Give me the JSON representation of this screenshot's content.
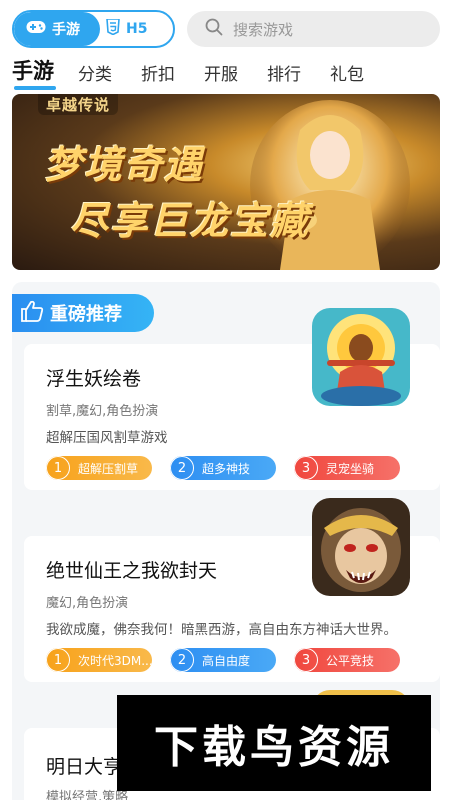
{
  "header": {
    "tabs": [
      {
        "label": "手游",
        "icon": "gamepad-icon",
        "active": true
      },
      {
        "label": "H5",
        "icon": "html5-icon",
        "active": false
      }
    ],
    "search": {
      "placeholder": "搜索游戏",
      "icon": "search-icon"
    }
  },
  "nav": {
    "items": [
      "手游",
      "分类",
      "折扣",
      "开服",
      "排行",
      "礼包"
    ],
    "active_index": 0
  },
  "banner": {
    "logo": "卓越传说",
    "line1": "梦境奇遇",
    "line2": "尽享巨龙宝藏"
  },
  "section": {
    "title": "重磅推荐",
    "icon": "thumbs-up-icon"
  },
  "games": [
    {
      "title": "浮生妖绘卷",
      "genre": "割草,魔幻,角色扮演",
      "desc": "超解压国风割草游戏",
      "tags": [
        {
          "num": "1",
          "label": "超解压割草"
        },
        {
          "num": "2",
          "label": "超多神技"
        },
        {
          "num": "3",
          "label": "灵宠坐骑"
        }
      ]
    },
    {
      "title": "绝世仙王之我欲封天",
      "genre": "魔幻,角色扮演",
      "desc": "我欲成魔，佛奈我何！暗黑西游，高自由东方神话大世界。",
      "tags": [
        {
          "num": "1",
          "label": "次时代3DM..."
        },
        {
          "num": "2",
          "label": "高自由度"
        },
        {
          "num": "3",
          "label": "公平竞技"
        }
      ]
    },
    {
      "title": "明日大亨",
      "genre": "模拟经营,策略"
    }
  ],
  "watermark": {
    "text": "下载鸟资源"
  },
  "colors": {
    "accent": "#2fa6ef",
    "tag_orange": "#f7a21b",
    "tag_blue": "#2d8ef2",
    "tag_red": "#f0473e"
  }
}
